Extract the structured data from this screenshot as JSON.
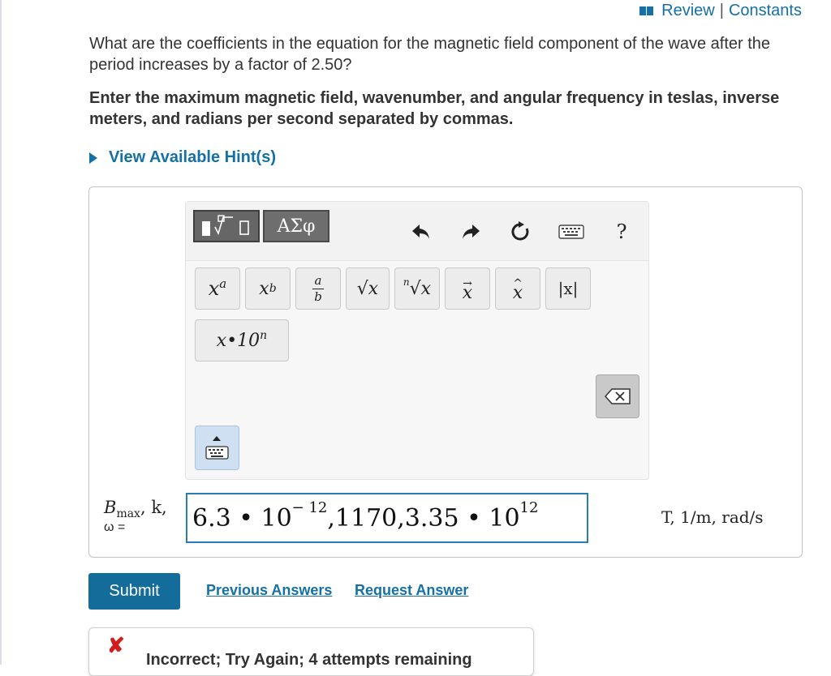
{
  "header": {
    "review_label": "Review",
    "separator": "|",
    "constants_label": "Constants"
  },
  "question": {
    "text": "What are the coefficients in the equation for the magnetic field component of the wave after the period increases by a factor of 2.50?",
    "instruction": "Enter the maximum magnetic field, wavenumber, and angular frequency in teslas, inverse meters, and radians per second separated by commas."
  },
  "hint": {
    "label": "View Available Hint(s)"
  },
  "toolbar": {
    "greek_label": "ΑΣφ",
    "help_label": "?",
    "templates": {
      "superscript": {
        "base": "x",
        "exp": "a"
      },
      "subscript": {
        "base": "x",
        "sub": "b"
      },
      "fraction": {
        "num": "a",
        "den": "b"
      },
      "sqrt": "√x",
      "nthroot": {
        "index": "n",
        "body": "√x"
      },
      "vector": "x",
      "unitvec": "x",
      "abs": "|x|",
      "sci": {
        "base": "x•10",
        "exp": "n"
      }
    }
  },
  "answer": {
    "var_label_line1": "Bmax, k,",
    "var_label_bmax": "B",
    "var_label_sub": "max",
    "var_label_rest": ", k,",
    "var_label_line2": "ω =",
    "input_parts": {
      "a1": "6.3 • 10",
      "a1_exp": "− 12",
      "a2": ",1170,3.35 • 10",
      "a2_exp": "12"
    },
    "units": "T, 1/m, rad/s"
  },
  "actions": {
    "submit_label": "Submit",
    "previous_label": "Previous Answers",
    "request_label": "Request Answer"
  },
  "feedback": {
    "icon": "✘",
    "text": "Incorrect; Try Again; 4 attempts remaining"
  },
  "colors": {
    "link": "#1570a6",
    "submit": "#136c99",
    "input_border": "#2a7cb8",
    "error": "#d41c1c"
  }
}
